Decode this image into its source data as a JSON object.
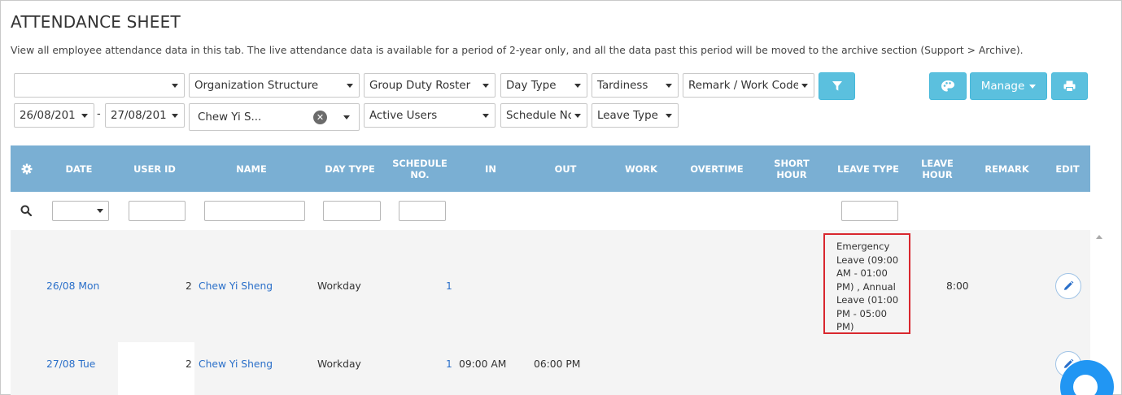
{
  "page": {
    "title": "ATTENDANCE SHEET",
    "description": "View all employee attendance data in this tab. The live attendance data is available for a period of 2-year only, and all the data past this period will be moved to the archive section (Support > Archive)."
  },
  "filters": {
    "row1": {
      "first_select": "",
      "organization": "Organization Structure",
      "roster": "Group Duty Roster",
      "day_type": "Day Type",
      "tardiness": "Tardiness",
      "remark": "Remark / Work Code"
    },
    "row2": {
      "date_from": "26/08/201",
      "date_separator": "-",
      "date_to": "27/08/201",
      "user": "Chew Yi S...",
      "users_status": "Active Users",
      "schedule": "Schedule No",
      "leave_type": "Leave Type"
    },
    "clear_symbol": "✕"
  },
  "toolbar": {
    "manage_label": "Manage",
    "icons": [
      "filter-icon",
      "palette-icon",
      "print-icon"
    ]
  },
  "table": {
    "headers": [
      "DATE",
      "USER ID",
      "NAME",
      "DAY TYPE",
      "SCHEDULE NO.",
      "IN",
      "OUT",
      "WORK",
      "OVERTIME",
      "SHORT HOUR",
      "LEAVE TYPE",
      "LEAVE HOUR",
      "REMARK",
      "EDIT"
    ],
    "rows": [
      {
        "date": "26/08 Mon",
        "user_id": "2",
        "name": "Chew Yi Sheng",
        "day_type": "Workday",
        "schedule": "1",
        "in": "",
        "out": "",
        "leave_type": "Emergency Leave (09:00 AM - 01:00 PM) , Annual Leave (01:00 PM - 05:00 PM)",
        "leave_hour": "8:00"
      },
      {
        "date": "27/08 Tue",
        "user_id": "2",
        "name": "Chew Yi Sheng",
        "day_type": "Workday",
        "schedule": "1",
        "in": "09:00 AM",
        "out": "06:00 PM",
        "leave_type": "",
        "leave_hour": ""
      }
    ]
  },
  "colors": {
    "header_bg": "#7aafd3",
    "button_bg": "#5bc0de",
    "link": "#2a6fc9",
    "highlight_border": "#d9272e",
    "chat": "#2196f3"
  }
}
